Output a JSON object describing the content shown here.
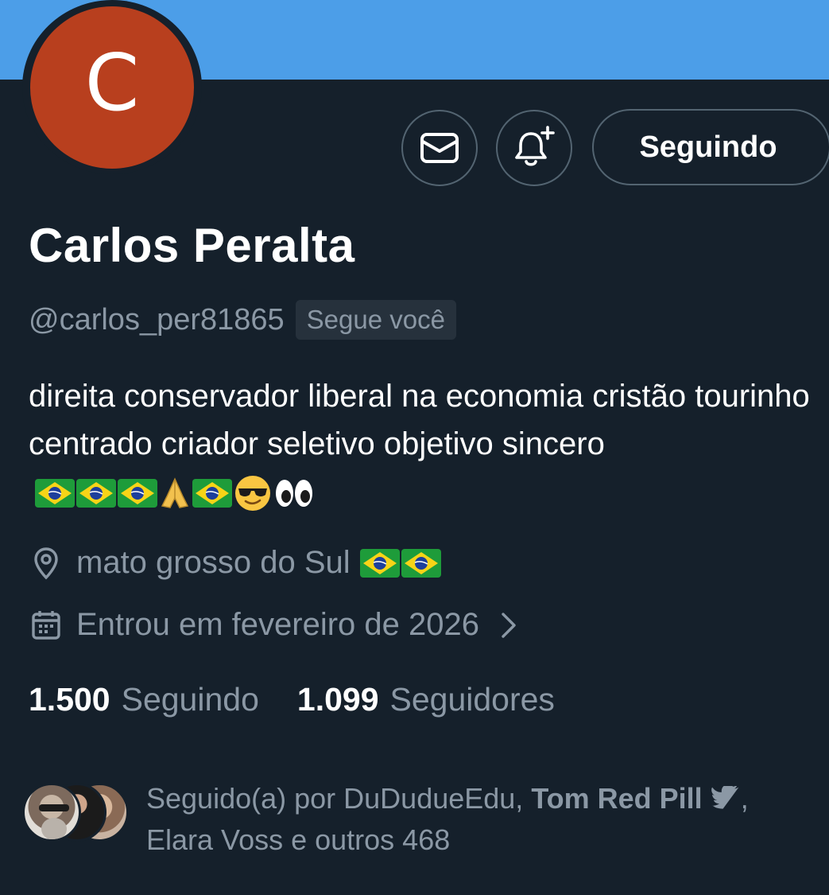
{
  "profile": {
    "avatar_letter": "C",
    "avatar_color": "#b83f1e",
    "banner_color": "#4c9ee8",
    "display_name": "Carlos Peralta",
    "handle": "@carlos_per81865",
    "follows_you": "Segue você",
    "bio_text": "direita conservador liberal na economia cristão tourinho centrado criador seletivo objetivo sincero",
    "bio_emojis": [
      "brazil-flag",
      "brazil-flag",
      "brazil-flag",
      "folded-hands",
      "brazil-flag",
      "smiling-face-with-sunglasses",
      "eyes"
    ],
    "location": "mato grosso do Sul",
    "location_emojis": [
      "brazil-flag",
      "brazil-flag"
    ],
    "joined": "Entrou em fevereiro de 2026",
    "following_count": "1.500",
    "following_label": "Seguindo",
    "followers_count": "1.099",
    "followers_label": "Seguidores"
  },
  "actions": {
    "message_icon": "mail-icon",
    "notify_icon": "bell-plus-icon",
    "follow_button": "Seguindo"
  },
  "followed_by": {
    "prefix": "Seguido(a) por DuDudueEdu,",
    "bold_name": "Tom Red Pill",
    "suffix": ",",
    "line2": "Elara Voss e outros 468"
  }
}
